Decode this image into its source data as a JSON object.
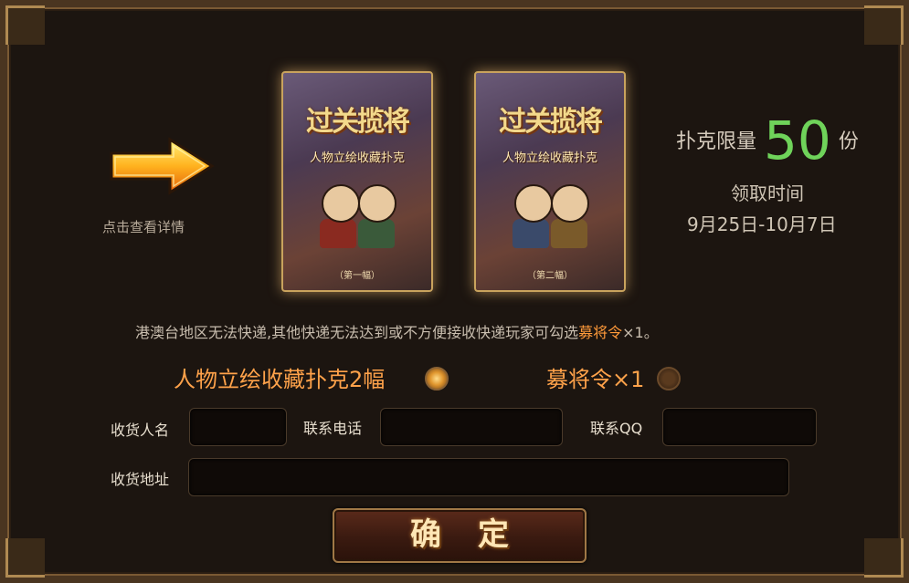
{
  "promo": {
    "hint_text": "点击查看详情",
    "cards": [
      {
        "title": "过关揽将",
        "subtitle": "人物立绘收藏扑克",
        "edition": "（第一幅）"
      },
      {
        "title": "过关揽将",
        "subtitle": "人物立绘收藏扑克",
        "edition": "（第二幅）"
      }
    ],
    "limit_prefix": "扑克限量",
    "limit_value": "50",
    "limit_unit": "份",
    "time_label": "领取时间",
    "time_value": "9月25日-10月7日"
  },
  "notice": {
    "text": "港澳台地区无法快递,其他快递无法达到或不方便接收快递玩家可勾选",
    "highlight": "募将令",
    "suffix": "×1。"
  },
  "options": [
    {
      "label": "人物立绘收藏扑克2幅",
      "selected": true
    },
    {
      "label": "募将令×1",
      "selected": false
    }
  ],
  "form": {
    "receiver_label": "收货人名",
    "phone_label": "联系电话",
    "qq_label": "联系QQ",
    "address_label": "收货地址",
    "receiver_value": "",
    "phone_value": "",
    "qq_value": "",
    "address_value": ""
  },
  "confirm_label": "确定",
  "colors": {
    "accent": "#ffa24a",
    "limit_number": "#6fd35a",
    "highlight": "#ff9a3a"
  }
}
